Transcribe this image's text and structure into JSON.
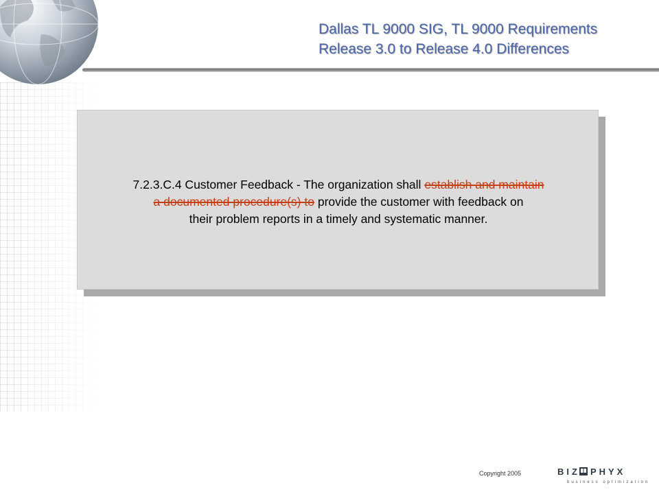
{
  "header": {
    "title_line1": "Dallas TL 9000 SIG, TL 9000 Requirements",
    "title_line2": "Release 3.0 to Release 4.0 Differences"
  },
  "content": {
    "line1_plain": "7.2.3.C.4 Customer Feedback - The organization shall ",
    "line1_struck": "establish and maintain",
    "line2_struck": "a documented procedure(s) to",
    "line2_plain": " provide the customer with feedback on",
    "line3_plain": "their problem reports in a timely and systematic manner."
  },
  "footer": {
    "copyright": "Copyright 2005",
    "logo_left": "BIZ",
    "logo_right": "PHYX",
    "logo_tagline": "business optimization"
  },
  "colors": {
    "title": "#4a65a8",
    "strikethrough": "#c53d13",
    "card": "#dcdcdc",
    "card_shadow": "#a9a9a9"
  },
  "icons": {
    "header_graphic": "globe-icon",
    "logo_mark": "book-icon"
  }
}
